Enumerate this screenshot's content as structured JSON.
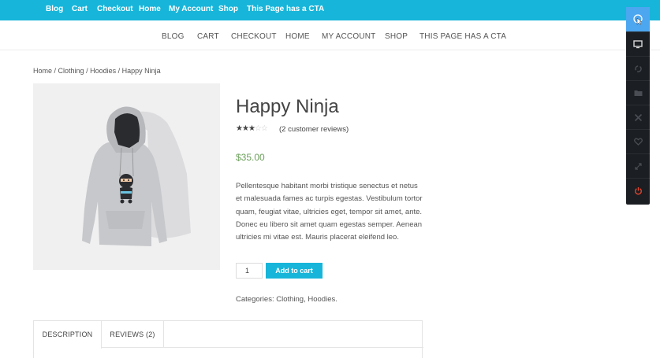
{
  "topbar": {
    "items": [
      "Blog",
      "Cart",
      "Checkout",
      "Home",
      "My Account",
      "Shop",
      "This Page has a CTA"
    ]
  },
  "mainnav": {
    "items": [
      "BLOG",
      "CART",
      "CHECKOUT",
      "HOME",
      "MY ACCOUNT",
      "SHOP",
      "THIS PAGE HAS A CTA"
    ]
  },
  "breadcrumb": {
    "home": "Home",
    "sep": " / ",
    "clothing": "Clothing",
    "hoodies": "Hoodies",
    "current": "Happy Ninja"
  },
  "product": {
    "title": "Happy Ninja",
    "rating": 3,
    "rating_max": 5,
    "reviews_text": "(2 customer reviews)",
    "price": "$35.00",
    "description": "Pellentesque habitant morbi tristique senectus et netus et malesuada fames ac turpis egestas. Vestibulum tortor quam, feugiat vitae, ultricies eget, tempor sit amet, ante. Donec eu libero sit amet quam egestas semper. Aenean ultricies mi vitae est. Mauris placerat eleifend leo.",
    "quantity": "1",
    "add_to_cart": "Add to cart",
    "categories_label": "Categories: ",
    "cat_clothing": "Clothing",
    "cat_sep": ", ",
    "cat_hoodies": "Hoodies",
    "cat_end": "."
  },
  "tabs": {
    "description": "DESCRIPTION",
    "reviews": "REVIEWS (2)"
  },
  "sidebar": {
    "icons": [
      "cursor-icon",
      "monitor-icon",
      "sync-icon",
      "folder-icon",
      "tools-icon",
      "heart-icon",
      "expand-icon",
      "power-icon"
    ]
  },
  "colors": {
    "accent": "#17b5d9",
    "price": "#6b9f5a",
    "toolbar": "#1b1e22",
    "toolbar_active": "#4da6f0"
  }
}
